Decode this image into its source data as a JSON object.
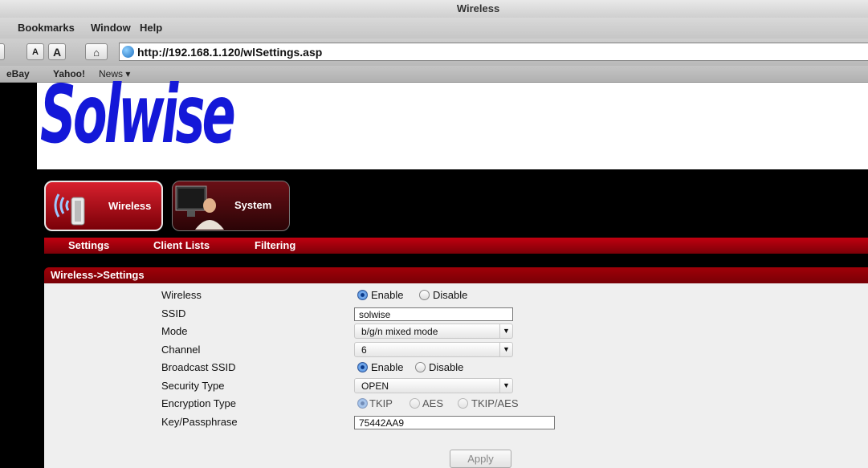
{
  "window": {
    "title": "Wireless"
  },
  "menu": [
    "Bookmarks",
    "Window",
    "Help"
  ],
  "toolbar": {
    "font_small": "A",
    "font_large": "A",
    "home_icon": "home-icon",
    "url": "http://192.168.1.120/wlSettings.asp"
  },
  "bookmarks": [
    "eBay",
    "Yahoo!",
    "News ▾"
  ],
  "logo": "Solwise",
  "nav": {
    "wireless": "Wireless",
    "system": "System"
  },
  "subnav": [
    "Settings",
    "Client Lists",
    "Filtering"
  ],
  "panel": {
    "title": "Wireless->Settings"
  },
  "form": {
    "labels": {
      "wireless": "Wireless",
      "ssid": "SSID",
      "mode": "Mode",
      "channel": "Channel",
      "broadcast": "Broadcast SSID",
      "security": "Security Type",
      "encryption": "Encryption Type",
      "key": "Key/Passphrase"
    },
    "enable": "Enable",
    "disable": "Disable",
    "ssid_value": "solwise",
    "mode_value": "b/g/n mixed mode",
    "channel_value": "6",
    "security_value": "OPEN",
    "enc_tkip": "TKIP",
    "enc_aes": "AES",
    "enc_tkipaes": "TKIP/AES",
    "key_value": "75442AA9",
    "apply": "Apply"
  },
  "colors": {
    "logo": "#1418d8",
    "accent": "#b0000c"
  }
}
